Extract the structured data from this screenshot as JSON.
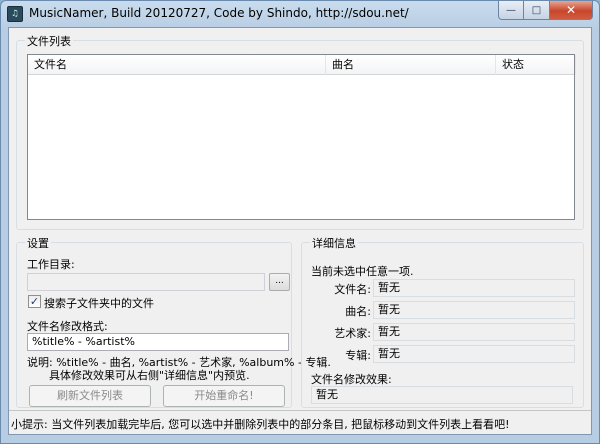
{
  "window": {
    "title": "MusicNamer, Build 20120727, Code by Shindo, http://sdou.net/",
    "icon": "app-icon",
    "controls": {
      "minimize": "—",
      "maximize": "□",
      "close": "✕"
    }
  },
  "file_list": {
    "group_label": "文件列表",
    "columns": [
      "文件名",
      "曲名",
      "状态"
    ],
    "rows": []
  },
  "settings": {
    "group_label": "设置",
    "workdir_label": "工作目录:",
    "workdir_value": "",
    "browse_label": "...",
    "search_subfolders_label": "搜索子文件夹中的文件",
    "search_subfolders_checked": true,
    "format_label": "文件名修改格式:",
    "format_value": "%title% - %artist%",
    "help_line1": "说明: %title% - 曲名, %artist% - 艺术家, %album% - 专辑.",
    "help_line2": "具体修改效果可从右侧\"详细信息\"内预览.",
    "refresh_button": "刷新文件列表",
    "rename_button": "开始重命名!"
  },
  "details": {
    "group_label": "详细信息",
    "none_selected": "当前未选中任意一项.",
    "fields": [
      {
        "label": "文件名:",
        "value": "暂无"
      },
      {
        "label": "曲名:",
        "value": "暂无"
      },
      {
        "label": "艺术家:",
        "value": "暂无"
      },
      {
        "label": "专辑:",
        "value": "暂无"
      }
    ],
    "result_label": "文件名修改效果:",
    "result_value": "暂无"
  },
  "status_bar": {
    "tip": "小提示: 当文件列表加载完毕后, 您可以选中并删除列表中的部分条目, 把鼠标移动到文件列表上看看吧!"
  }
}
